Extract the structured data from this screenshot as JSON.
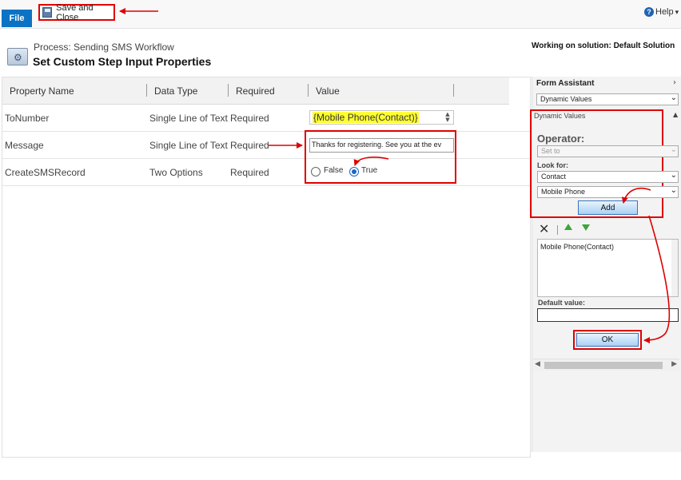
{
  "ribbon": {
    "file_label": "File",
    "save_close_label": "Save and Close",
    "help_label": "Help",
    "help_caret": "▾"
  },
  "header": {
    "process_label": "Process: Sending SMS Workflow",
    "title": "Set Custom Step Input Properties",
    "solution": "Working on solution: Default Solution"
  },
  "grid": {
    "columns": [
      "Property Name",
      "Data Type",
      "Required",
      "Value"
    ],
    "rows": [
      {
        "name": "ToNumber",
        "type": "Single Line of Text",
        "required": "Required",
        "value": "{Mobile Phone(Contact)}"
      },
      {
        "name": "Message",
        "type": "Single Line of Text",
        "required": "Required",
        "value": "Thanks for registering. See you at the ev"
      },
      {
        "name": "CreateSMSRecord",
        "type": "Two Options",
        "required": "Required",
        "value_false": "False",
        "value_true": "True",
        "selected": "True"
      }
    ]
  },
  "assistant": {
    "title": "Form Assistant",
    "mode_select": "Dynamic Values",
    "section_header": "Dynamic Values",
    "operator_label": "Operator:",
    "operator_value": "Set to",
    "look_for_label": "Look for:",
    "entity_value": "Contact",
    "field_value": "Mobile Phone",
    "add_label": "Add",
    "list_item": "Mobile Phone(Contact)",
    "default_label": "Default value:",
    "default_value": "",
    "ok_label": "OK"
  },
  "colors": {
    "file_blue": "#0c72c3",
    "annotation_red": "#e00000",
    "highlight_yellow": "#ffff33"
  }
}
